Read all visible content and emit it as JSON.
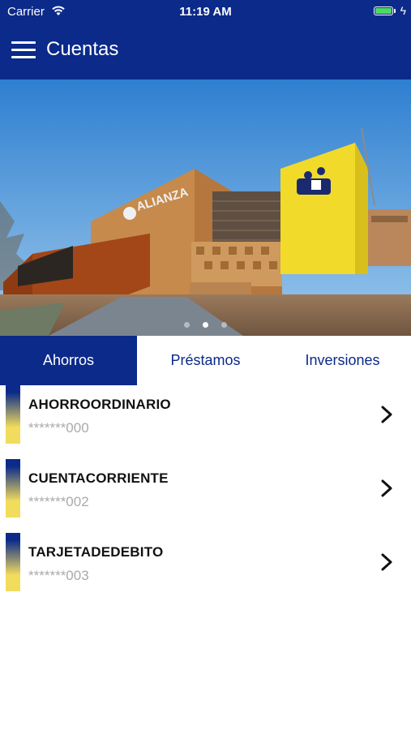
{
  "status_bar": {
    "carrier": "Carrier",
    "time": "11:19 AM"
  },
  "header": {
    "title": "Cuentas",
    "menu_icon": "hamburger-menu-icon"
  },
  "hero": {
    "current_slide": 2,
    "total_slides": 3,
    "building_sign": "ALIANZA"
  },
  "tabs": [
    {
      "label": "Ahorros",
      "active": true
    },
    {
      "label": "Préstamos",
      "active": false
    },
    {
      "label": "Inversiones",
      "active": false
    }
  ],
  "accounts": [
    {
      "name": "AHORROORDINARIO",
      "number": "*******000"
    },
    {
      "name": "CUENTACORRIENTE",
      "number": "*******002"
    },
    {
      "name": "TARJETADEDEBITO",
      "number": "*******003"
    }
  ],
  "colors": {
    "primary": "#0b2a8a",
    "accent_yellow": "#f2dc5d",
    "battery": "#4cd964"
  }
}
